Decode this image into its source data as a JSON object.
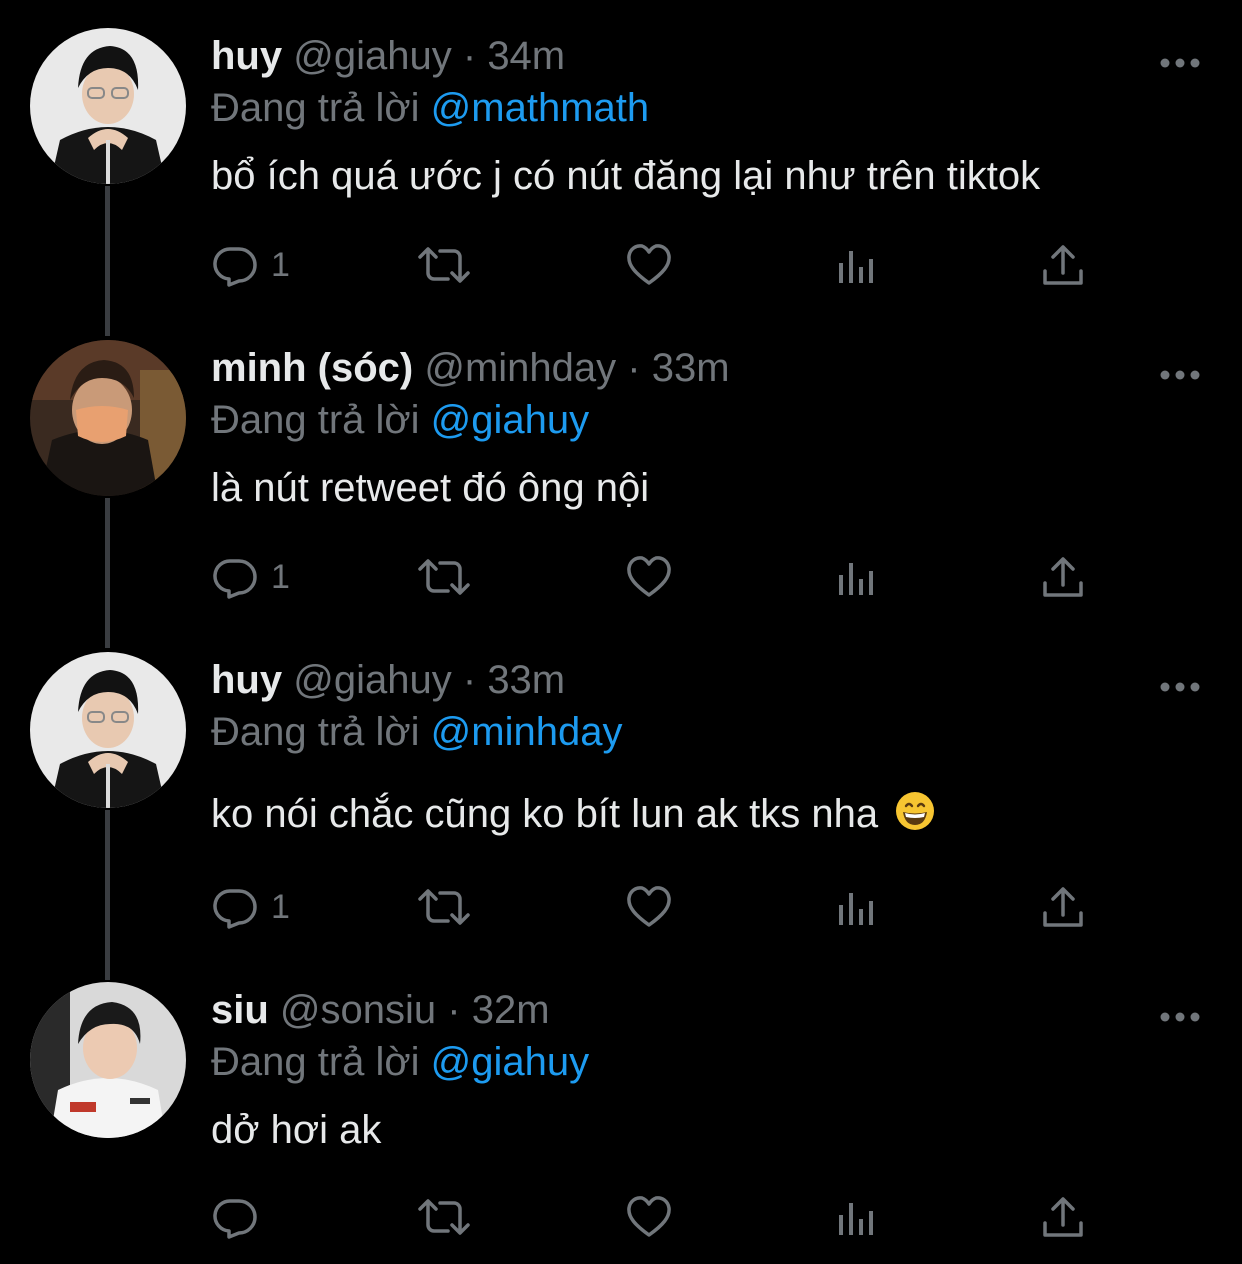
{
  "replying_prefix": "Đang trả lời",
  "colors": {
    "background": "#000000",
    "text": "#e7e9ea",
    "muted": "#71767b",
    "accent": "#1d9bf0",
    "thread_line": "#3a3d41"
  },
  "icons": {
    "reply": "reply-icon",
    "retweet": "retweet-icon",
    "like": "heart-icon",
    "analytics": "analytics-icon",
    "share": "share-icon",
    "more": "more-icon"
  },
  "tweets": [
    {
      "name": "huy",
      "handle": "@giahuy",
      "separator": "·",
      "time": "34m",
      "replying_to": "@mathmath",
      "text": "bổ ích quá ước j có nút đăng lại như trên tiktok",
      "reply_count": "1"
    },
    {
      "name": "minh (sóc)",
      "handle": "@minhday",
      "separator": "·",
      "time": "33m",
      "replying_to": "@giahuy",
      "text": "là nút retweet đó ông nội",
      "reply_count": "1"
    },
    {
      "name": "huy",
      "handle": "@giahuy",
      "separator": "·",
      "time": "33m",
      "replying_to": "@minhday",
      "text": "ko nói chắc cũng ko bít lun ak tks nha",
      "emoji": "grinning-face-emoji",
      "reply_count": "1"
    },
    {
      "name": "siu",
      "handle": "@sonsiu",
      "separator": "·",
      "time": "32m",
      "replying_to": "@giahuy",
      "text": "dở hơi ak",
      "reply_count": ""
    }
  ]
}
